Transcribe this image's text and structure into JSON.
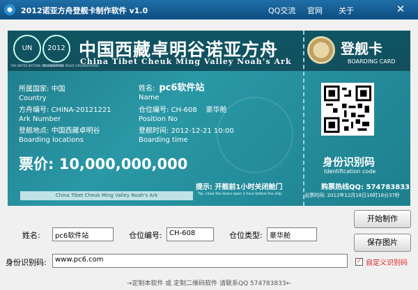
{
  "window": {
    "title": "2012诺亚方舟登舰卡制作软件 v1.0",
    "menu": [
      "QQ交流",
      "官网",
      "关于"
    ],
    "close": "✕"
  },
  "ticket": {
    "emblem_left_text": "UN",
    "emblem_right_text": "2012",
    "emblem_left_caption": "THE UNITED NATIONS ORGANIZATION",
    "emblem_right_caption": "2012 DISASTER RELIEF ORGANIZATIONS",
    "title_cn": "中国西藏卓明谷诺亚方舟",
    "title_en": "China Tibet Cheuk Ming Valley Noah’s Ark",
    "stub_title": "登舰卡",
    "stub_subtitle": "BOARDING CARD",
    "country_label": "所属国家:",
    "country_value": "中国",
    "country_en": "Country",
    "ark_label": "方舟编号:",
    "ark_value": "CHINA-20121221",
    "ark_en": "Ark Number",
    "location_label": "登舰地点:",
    "location_value": "中国西藏卓明谷",
    "location_en": "Boarding locations",
    "name_label": "姓名:",
    "name_value": "pc6软件站",
    "name_en": "Name",
    "position_label": "仓位编号:",
    "position_value": "CH-608",
    "position_type": "豪华舱",
    "position_en": "Position No",
    "time_label": "登舰时间:",
    "time_value": "2012-12-21 10:00",
    "time_en": "Boarding time",
    "price": "票价: 10,000,000,000",
    "strip_text": "China Tibet Cheuk Ming Valley Noah’s Ark",
    "notice": "提示: 开舰前1小时关闭舱门",
    "notice_en": "Tip: close the doors open 1 hour before the ship",
    "id_label": "身份识别码",
    "id_label_en": "Identification code",
    "hotline": "购票热线QQ: 574783833",
    "issue_time": "出票时间: 2012年12月18日16时18分37秒"
  },
  "form": {
    "name_label": "姓名:",
    "name_value": "pc6软件站",
    "position_label": "仓位编号:",
    "position_value": "CH-608",
    "type_label": "仓位类型:",
    "type_value": "豪华舱",
    "id_label": "身份识别码:",
    "id_value": "www.pc6.com",
    "custom_id_label": "自定义识别码",
    "custom_id_checked": "✓"
  },
  "buttons": {
    "start": "开始制作",
    "save": "保存图片"
  },
  "footer": "→定制本软件 或 定制二维码软件 请联系QQ 574783833←",
  "colors": {
    "ticket_bg": "#2a98a6",
    "header_bg": "#0f5563",
    "title_bar": "#1f6fa8",
    "accent_red": "#d22"
  }
}
